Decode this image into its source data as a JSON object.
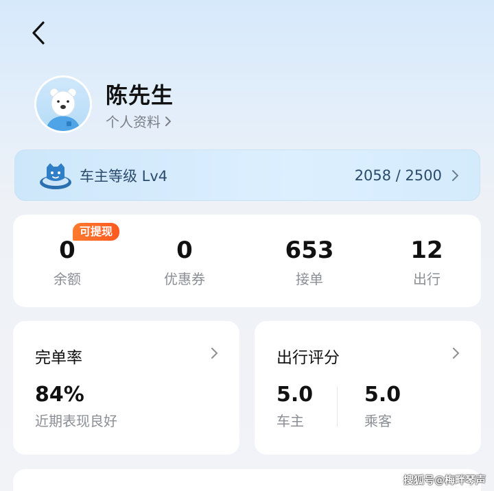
{
  "header": {
    "back_icon": "chevron-left-icon"
  },
  "user": {
    "name": "陈先生",
    "profile_link": "个人资料",
    "avatar": "polar-bear-avatar"
  },
  "level": {
    "label": "车主等级 Lv4",
    "progress_text": "2058 / 2500",
    "progress": {
      "current": 2058,
      "total": 2500
    }
  },
  "stats": {
    "badge": "可提现",
    "items": [
      {
        "value": "0",
        "label": "余额"
      },
      {
        "value": "0",
        "label": "优惠券"
      },
      {
        "value": "653",
        "label": "接单"
      },
      {
        "value": "12",
        "label": "出行"
      }
    ]
  },
  "completion": {
    "title": "完单率",
    "value": "84%",
    "desc": "近期表现良好"
  },
  "rating": {
    "title": "出行评分",
    "driver_value": "5.0",
    "driver_label": "车主",
    "passenger_value": "5.0",
    "passenger_label": "乘客"
  },
  "watermark": "搜狐号@梅畔琴声",
  "colors": {
    "badge": "#ff6a24",
    "level_text": "#2a4a6b",
    "muted_text": "#8b8f95"
  }
}
